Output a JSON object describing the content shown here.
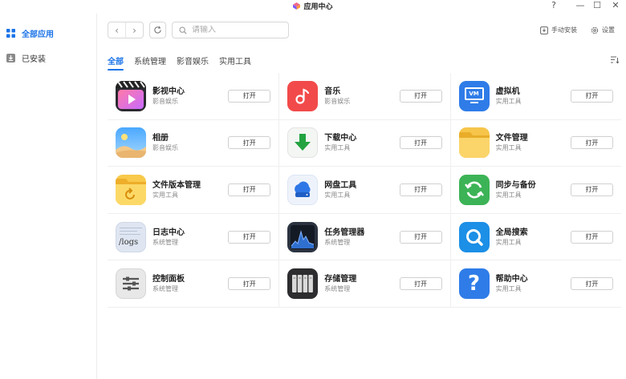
{
  "window": {
    "title": "应用中心",
    "controls": {
      "help": "?",
      "minimize": "—",
      "maximize": "☐",
      "close": "✕"
    }
  },
  "sidebar": {
    "items": [
      {
        "label": "全部应用",
        "icon": "grid-icon",
        "active": true
      },
      {
        "label": "已安装",
        "icon": "download-icon",
        "active": false
      }
    ]
  },
  "toolbar": {
    "back": "‹",
    "forward": "›",
    "search_placeholder": "请输入",
    "manual_install": "手动安装",
    "settings": "设置"
  },
  "tabs": [
    {
      "label": "全部",
      "active": true
    },
    {
      "label": "系统管理",
      "active": false
    },
    {
      "label": "影音娱乐",
      "active": false
    },
    {
      "label": "实用工具",
      "active": false
    }
  ],
  "open_label": "打开",
  "apps": [
    [
      {
        "name": "影视中心",
        "category": "影音娱乐",
        "icon": "video-center-icon"
      },
      {
        "name": "音乐",
        "category": "影音娱乐",
        "icon": "music-icon"
      },
      {
        "name": "虚拟机",
        "category": "实用工具",
        "icon": "vm-icon",
        "icon_text": "VM"
      }
    ],
    [
      {
        "name": "相册",
        "category": "影音娱乐",
        "icon": "photo-album-icon"
      },
      {
        "name": "下载中心",
        "category": "实用工具",
        "icon": "download-center-icon"
      },
      {
        "name": "文件管理",
        "category": "实用工具",
        "icon": "folder-icon"
      }
    ],
    [
      {
        "name": "文件版本管理",
        "category": "实用工具",
        "icon": "file-version-icon"
      },
      {
        "name": "网盘工具",
        "category": "实用工具",
        "icon": "cloud-disk-icon"
      },
      {
        "name": "同步与备份",
        "category": "实用工具",
        "icon": "sync-backup-icon"
      }
    ],
    [
      {
        "name": "日志中心",
        "category": "系统管理",
        "icon": "logs-icon",
        "icon_text": "/logs"
      },
      {
        "name": "任务管理器",
        "category": "系统管理",
        "icon": "task-manager-icon"
      },
      {
        "name": "全局搜索",
        "category": "实用工具",
        "icon": "global-search-icon"
      }
    ],
    [
      {
        "name": "控制面板",
        "category": "系统管理",
        "icon": "control-panel-icon"
      },
      {
        "name": "存储管理",
        "category": "系统管理",
        "icon": "storage-icon"
      },
      {
        "name": "帮助中心",
        "category": "实用工具",
        "icon": "help-center-icon",
        "icon_text": "?"
      }
    ]
  ],
  "colors": {
    "accent": "#1a73e8"
  }
}
